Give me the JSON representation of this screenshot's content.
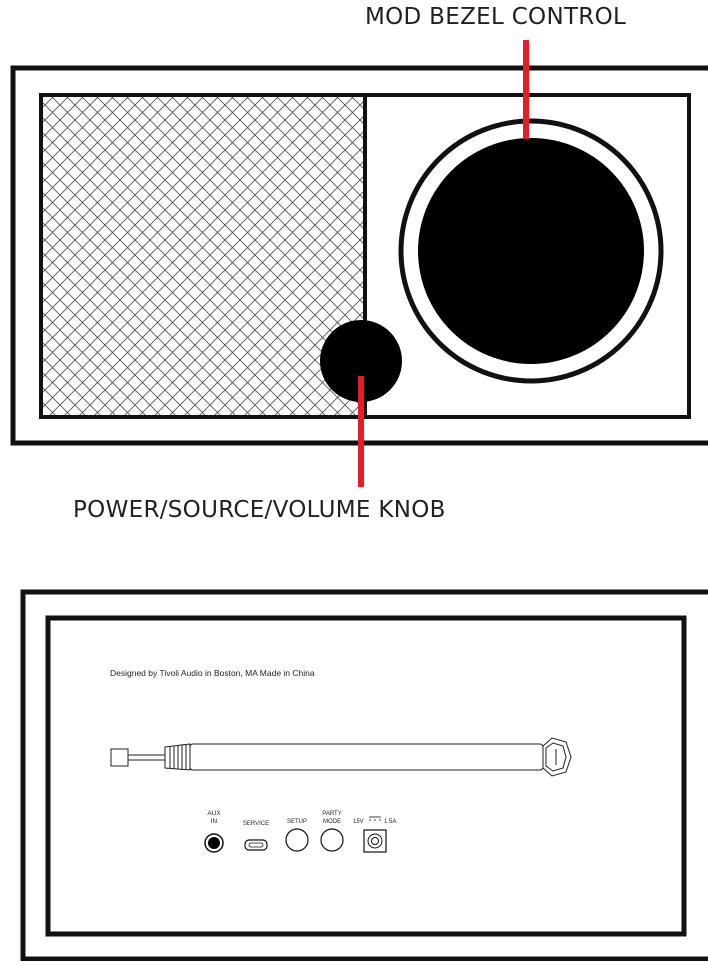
{
  "front_view": {
    "callouts": {
      "bezel_label": "MOD BEZEL CONTROL",
      "knob_label": "POWER/SOURCE/VOLUME KNOB"
    },
    "callout_color": "#e31e24"
  },
  "rear_view": {
    "design_note": "Designed by Tivoli Audio in Boston, MA Made in China",
    "ports": {
      "aux_line1": "AUX",
      "aux_line2": "IN",
      "service": "SERVICE",
      "setup": "SETUP",
      "party_line1": "PARTY",
      "party_line2": "MODE",
      "power_voltage": "15V",
      "power_current": "1.5A"
    }
  }
}
